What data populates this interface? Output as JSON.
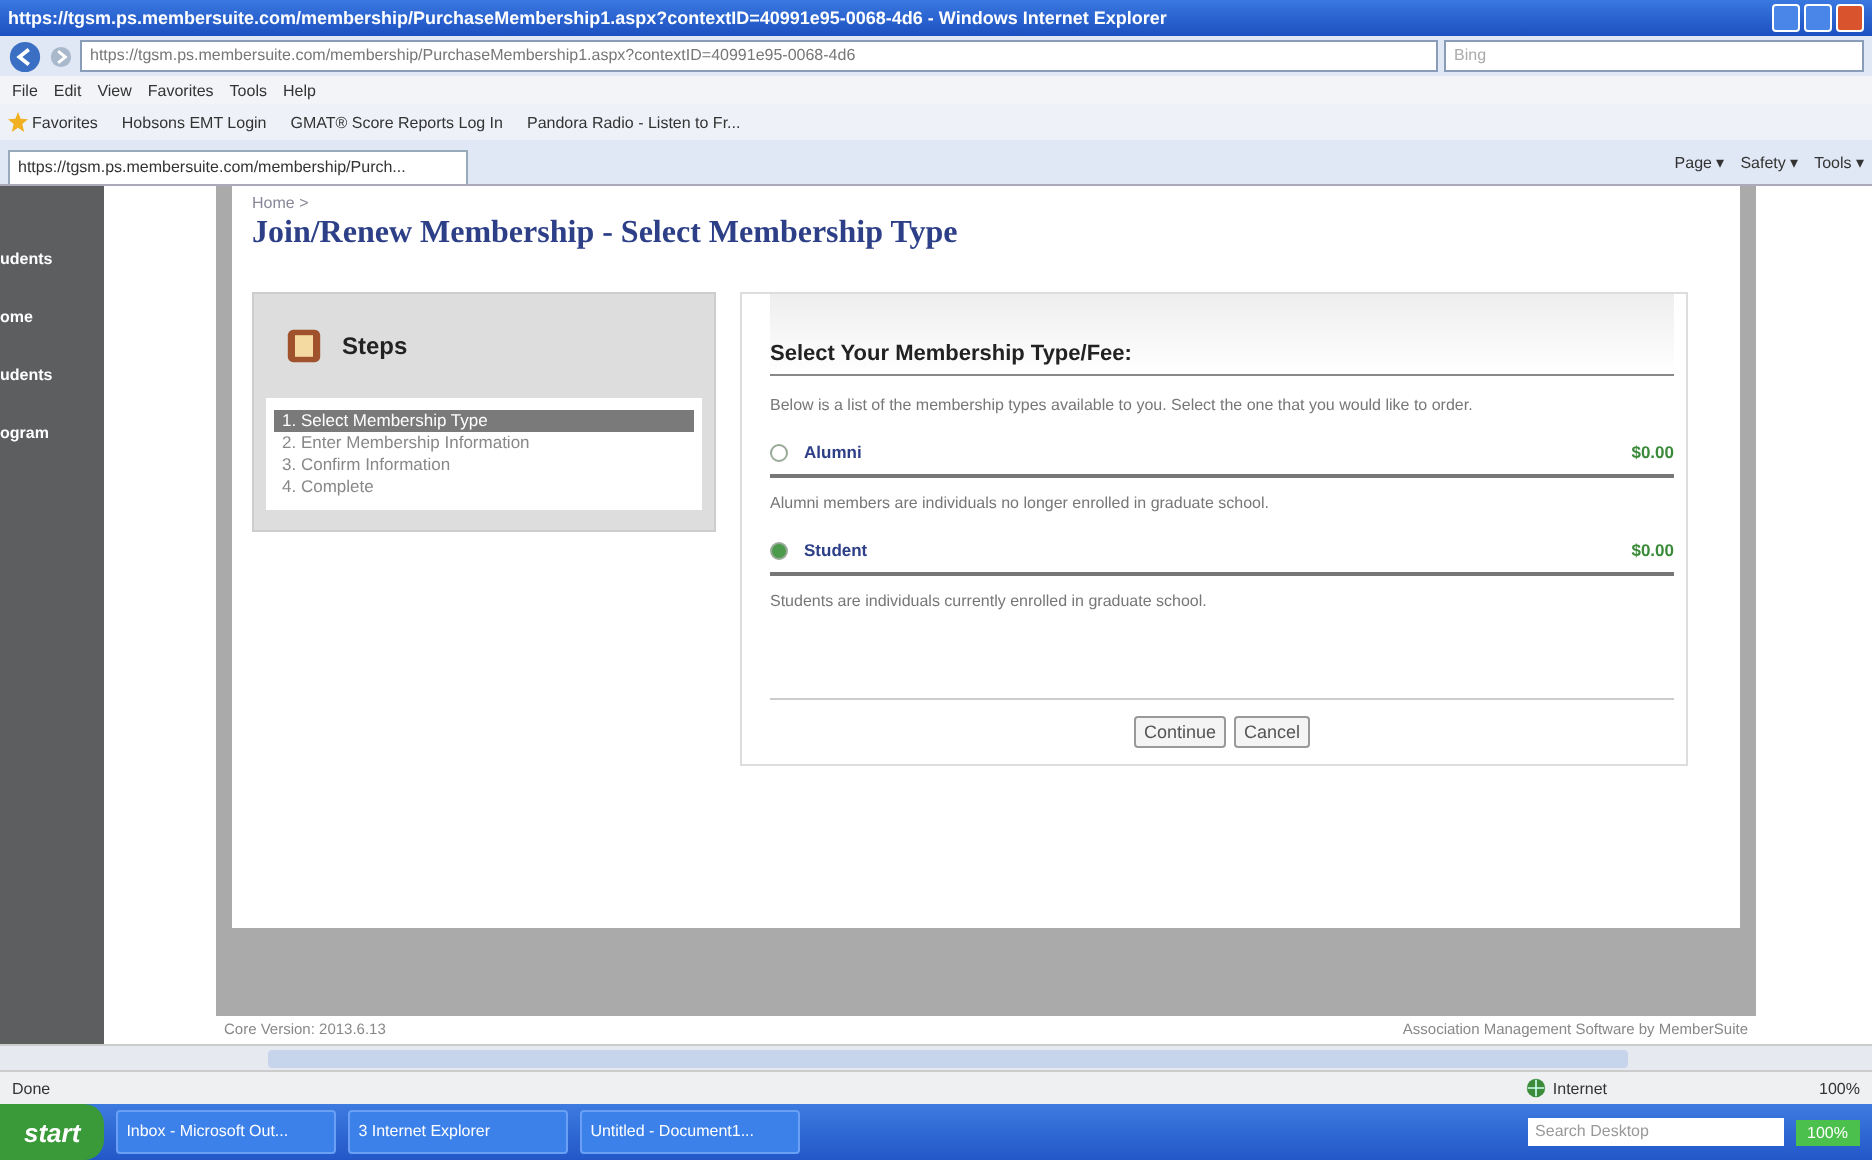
{
  "window": {
    "title": "https://tgsm.ps.membersuite.com/membership/PurchaseMembership1.aspx?contextID=40991e95-0068-4d6 - Windows Internet Explorer"
  },
  "address_bar": {
    "value": "https://tgsm.ps.membersuite.com/membership/PurchaseMembership1.aspx?contextID=40991e95-0068-4d6",
    "search_placeholder": "Bing"
  },
  "menu": [
    "File",
    "Edit",
    "View",
    "Favorites",
    "Tools",
    "Help"
  ],
  "favorites_bar": {
    "label": "Favorites",
    "links": [
      "Hobsons EMT Login",
      "GMAT® Score Reports Log In",
      "Pandora Radio - Listen to Fr..."
    ]
  },
  "tab": {
    "title": "https://tgsm.ps.membersuite.com/membership/Purch..."
  },
  "command_bar": [
    "Page ▾",
    "Safety ▾",
    "Tools ▾"
  ],
  "sidebar": {
    "items": [
      "udents",
      "ome",
      "udents",
      "ogram"
    ]
  },
  "page": {
    "breadcrumb": "Home >",
    "heading": "Join/Renew Membership - Select Membership Type",
    "steps": {
      "title": "Steps",
      "items": [
        {
          "label": "1. Select Membership Type",
          "selected": true
        },
        {
          "label": "2. Enter Membership Information",
          "selected": false
        },
        {
          "label": "3. Confirm Information",
          "selected": false
        },
        {
          "label": "4. Complete",
          "selected": false
        }
      ]
    },
    "types": {
      "title": "Select Your Membership Type/Fee:",
      "intro": "Below is a list of the membership types available to you. Select the one that you would like to order.",
      "options": [
        {
          "name": "Alumni",
          "fee": "$0.00",
          "description": "Alumni members are individuals no longer enrolled in graduate school.",
          "selected": false
        },
        {
          "name": "Student",
          "fee": "$0.00",
          "description": "Students are individuals currently enrolled in graduate school.",
          "selected": true
        }
      ]
    },
    "buttons": [
      "Continue",
      "Cancel"
    ],
    "footer_left": "Core Version: 2013.6.13",
    "footer_right": "Association Management Software by MemberSuite"
  },
  "status_bar": {
    "text": "Done",
    "zone": "Internet",
    "zoom": "100%"
  },
  "taskbar": {
    "start": "start",
    "tasks": [
      "Inbox - Microsoft Out...",
      "3 Internet Explorer",
      "Untitled - Document1..."
    ],
    "search_placeholder": "Search Desktop",
    "battery": "100%"
  }
}
